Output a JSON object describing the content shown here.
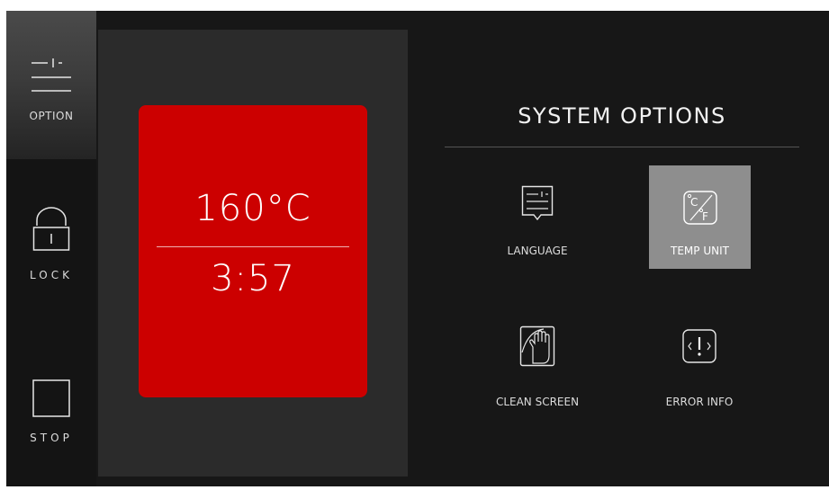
{
  "sidebar": {
    "option_label": "OPTION",
    "lock_label": "LOCK",
    "stop_label": "STOP"
  },
  "status": {
    "temperature": "160°C",
    "time": "3:57",
    "card_color": "#cc0000"
  },
  "system_options": {
    "title": "SYSTEM OPTIONS",
    "items": [
      {
        "label": "LANGUAGE",
        "icon": "language-icon",
        "selected": false
      },
      {
        "label": "TEMP UNIT",
        "icon": "temp-unit-icon",
        "selected": true
      },
      {
        "label": "CLEAN SCREEN",
        "icon": "clean-screen-icon",
        "selected": false
      },
      {
        "label": "ERROR INFO",
        "icon": "error-info-icon",
        "selected": false
      }
    ]
  }
}
